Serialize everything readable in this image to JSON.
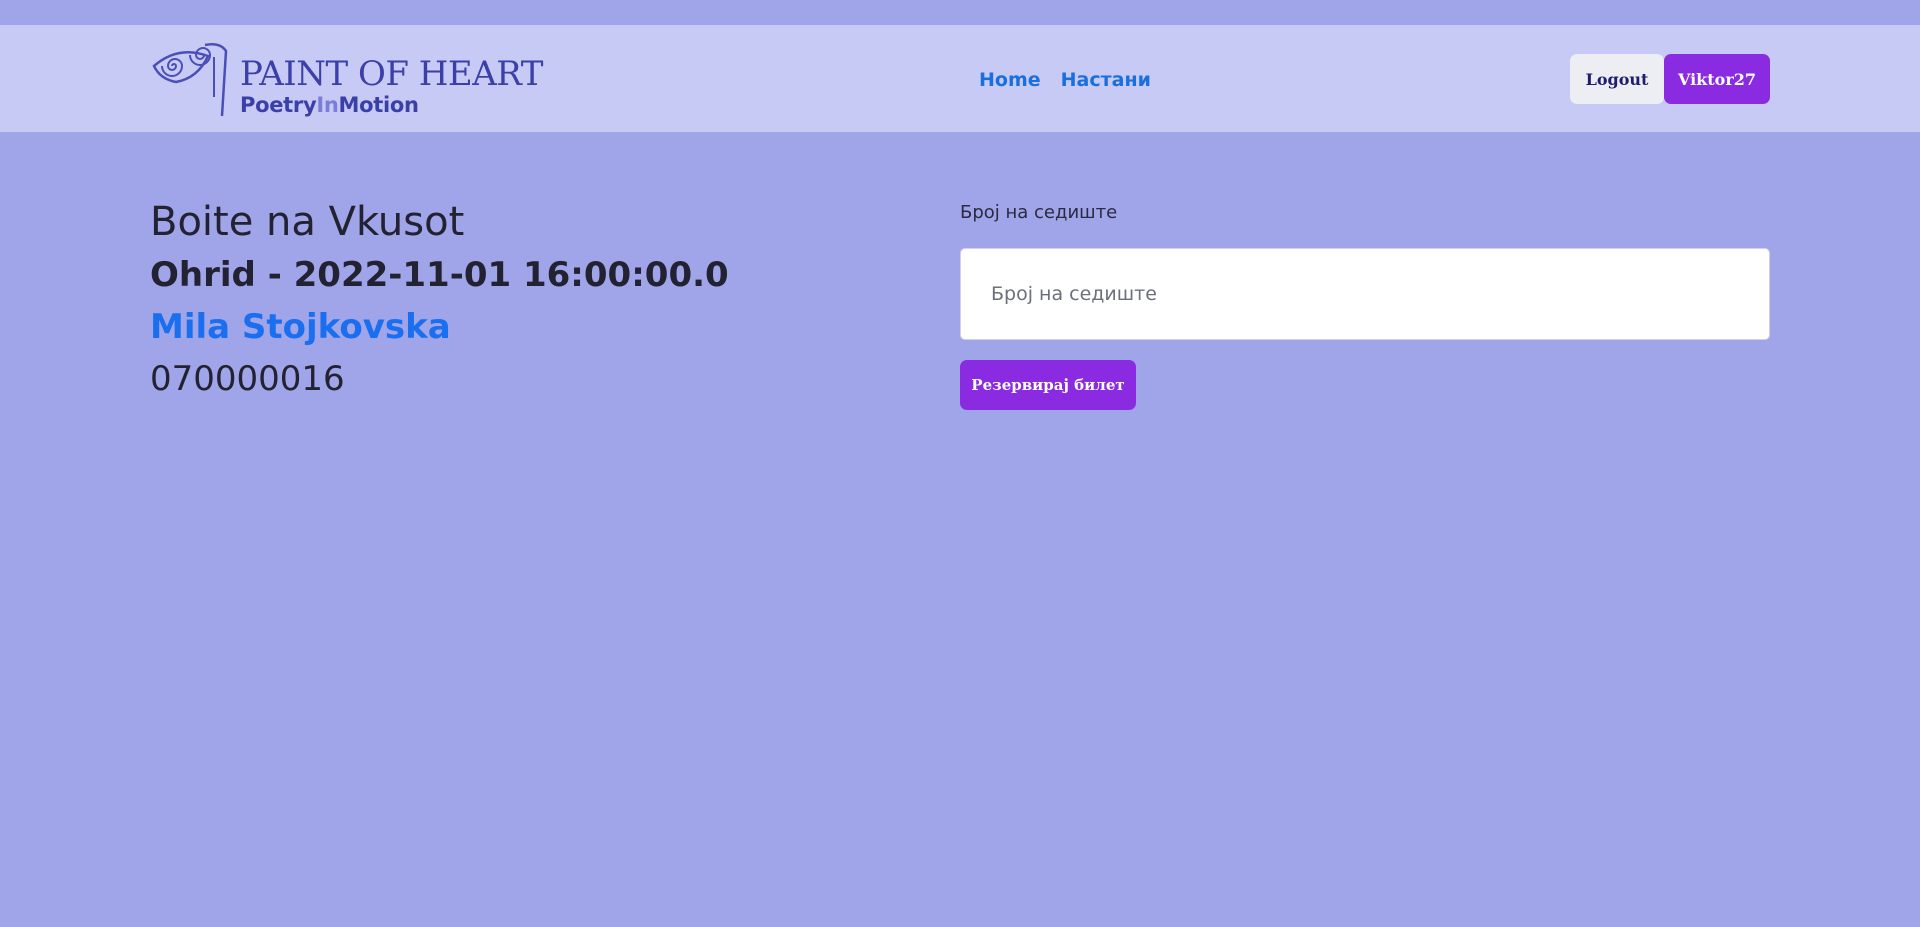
{
  "header": {
    "logo": {
      "title": "PAINT OF HEART",
      "subtitle_part1": "Poetry",
      "subtitle_part2": "In",
      "subtitle_part3": "Motion"
    },
    "nav": [
      {
        "label": "Home"
      },
      {
        "label": "Настани"
      }
    ],
    "logout_label": "Logout",
    "user_label": "Viktor27"
  },
  "event": {
    "title": "Boite na Vkusot",
    "location_datetime": "Ohrid - 2022-11-01 16:00:00.0",
    "person": "Mila Stojkovska",
    "phone": "070000016"
  },
  "reservation": {
    "seat_label": "Број на седиште",
    "seat_placeholder": "Број на седиште",
    "seat_value": "",
    "submit_label": "Резервирај билет"
  },
  "colors": {
    "page_background": "#a0a4e8",
    "navbar_background": "#c6caf4",
    "accent_purple": "#8a2be2",
    "link_blue": "#1a6fe0"
  },
  "icons": {
    "logo_mark": "spiral-eye-icon"
  }
}
